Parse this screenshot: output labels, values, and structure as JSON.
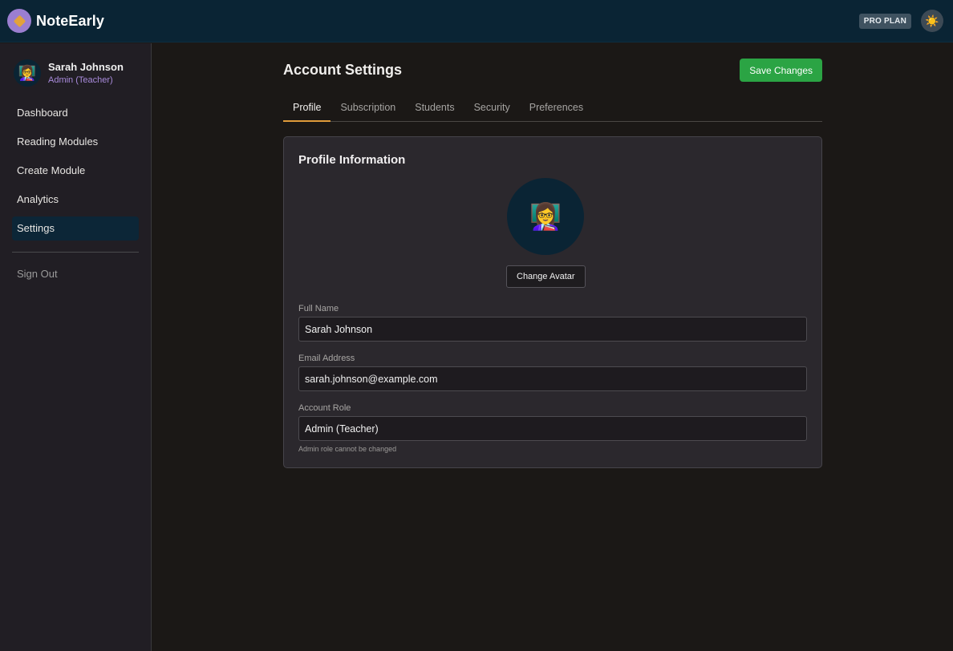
{
  "app": {
    "name": "NoteEarly",
    "plan_badge": "PRO PLAN",
    "theme_icon": "☀️"
  },
  "user": {
    "name": "Sarah Johnson",
    "role": "Admin (Teacher)",
    "avatar": "👩‍🏫"
  },
  "sidebar": {
    "items": [
      {
        "label": "Dashboard"
      },
      {
        "label": "Reading Modules"
      },
      {
        "label": "Create Module"
      },
      {
        "label": "Analytics"
      },
      {
        "label": "Settings",
        "active": true
      }
    ],
    "sign_out": "Sign Out"
  },
  "page": {
    "title": "Account Settings",
    "save_label": "Save Changes",
    "tabs": [
      {
        "label": "Profile",
        "active": true
      },
      {
        "label": "Subscription"
      },
      {
        "label": "Students"
      },
      {
        "label": "Security"
      },
      {
        "label": "Preferences"
      }
    ]
  },
  "profile": {
    "section_title": "Profile Information",
    "avatar": "👩‍🏫",
    "change_avatar_label": "Change Avatar",
    "full_name_label": "Full Name",
    "full_name_value": "Sarah Johnson",
    "email_label": "Email Address",
    "email_value": "sarah.johnson@example.com",
    "role_label": "Account Role",
    "role_value": "Admin (Teacher)",
    "role_helper": "Admin role cannot be changed"
  },
  "colors": {
    "topbar": "#0a2434",
    "accent_purple": "#a98bdc",
    "save_green": "#2ba444",
    "tab_underline": "#e09b3a"
  }
}
